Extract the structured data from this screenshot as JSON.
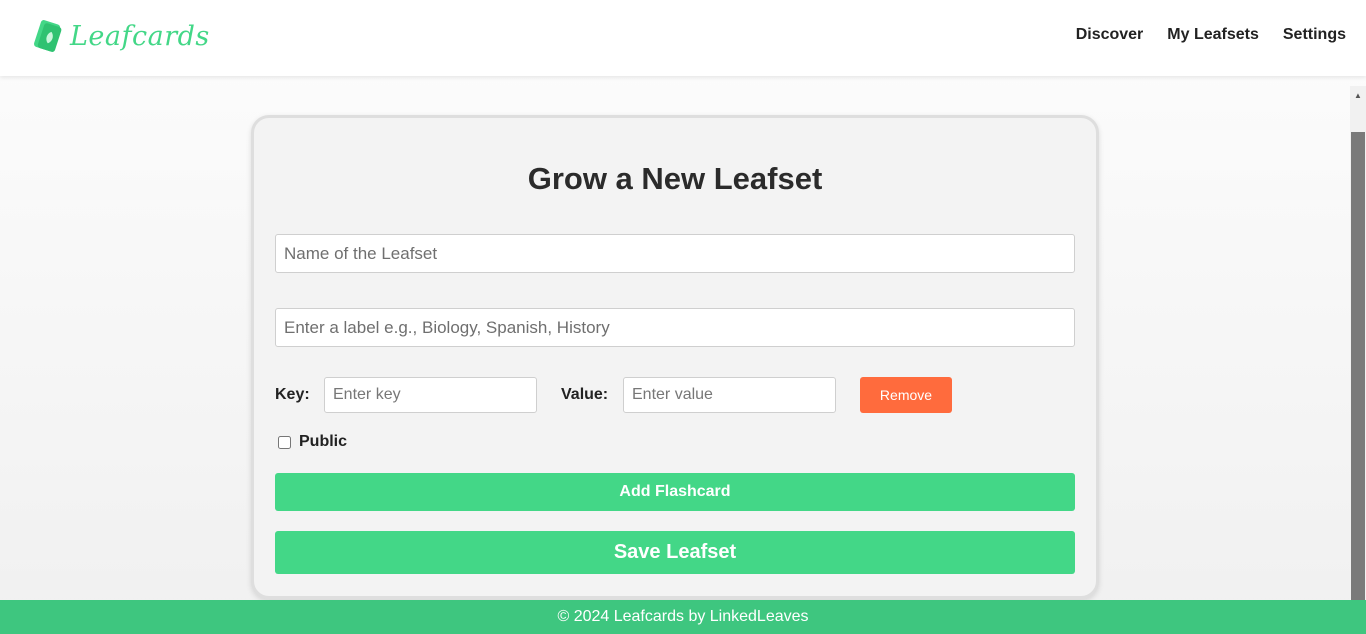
{
  "brand": {
    "name": "Leafcards",
    "icon": "leaf-card-icon",
    "color": "#43d787"
  },
  "nav": {
    "links": [
      "Discover",
      "My Leafsets",
      "Settings"
    ]
  },
  "form": {
    "title": "Grow a New Leafset",
    "name_placeholder": "Name of the Leafset",
    "label_placeholder": "Enter a label e.g., Biology, Spanish, History",
    "key_label": "Key:",
    "key_placeholder": "Enter key",
    "value_label": "Value:",
    "value_placeholder": "Enter value",
    "remove_label": "Remove",
    "public_label": "Public",
    "public_checked": false,
    "add_label": "Add Flashcard",
    "save_label": "Save Leafset"
  },
  "footer": {
    "text": "© 2024 Leafcards by LinkedLeaves"
  },
  "colors": {
    "accent": "#43d787",
    "remove": "#ff6b3d",
    "footer": "#3ec67f"
  }
}
